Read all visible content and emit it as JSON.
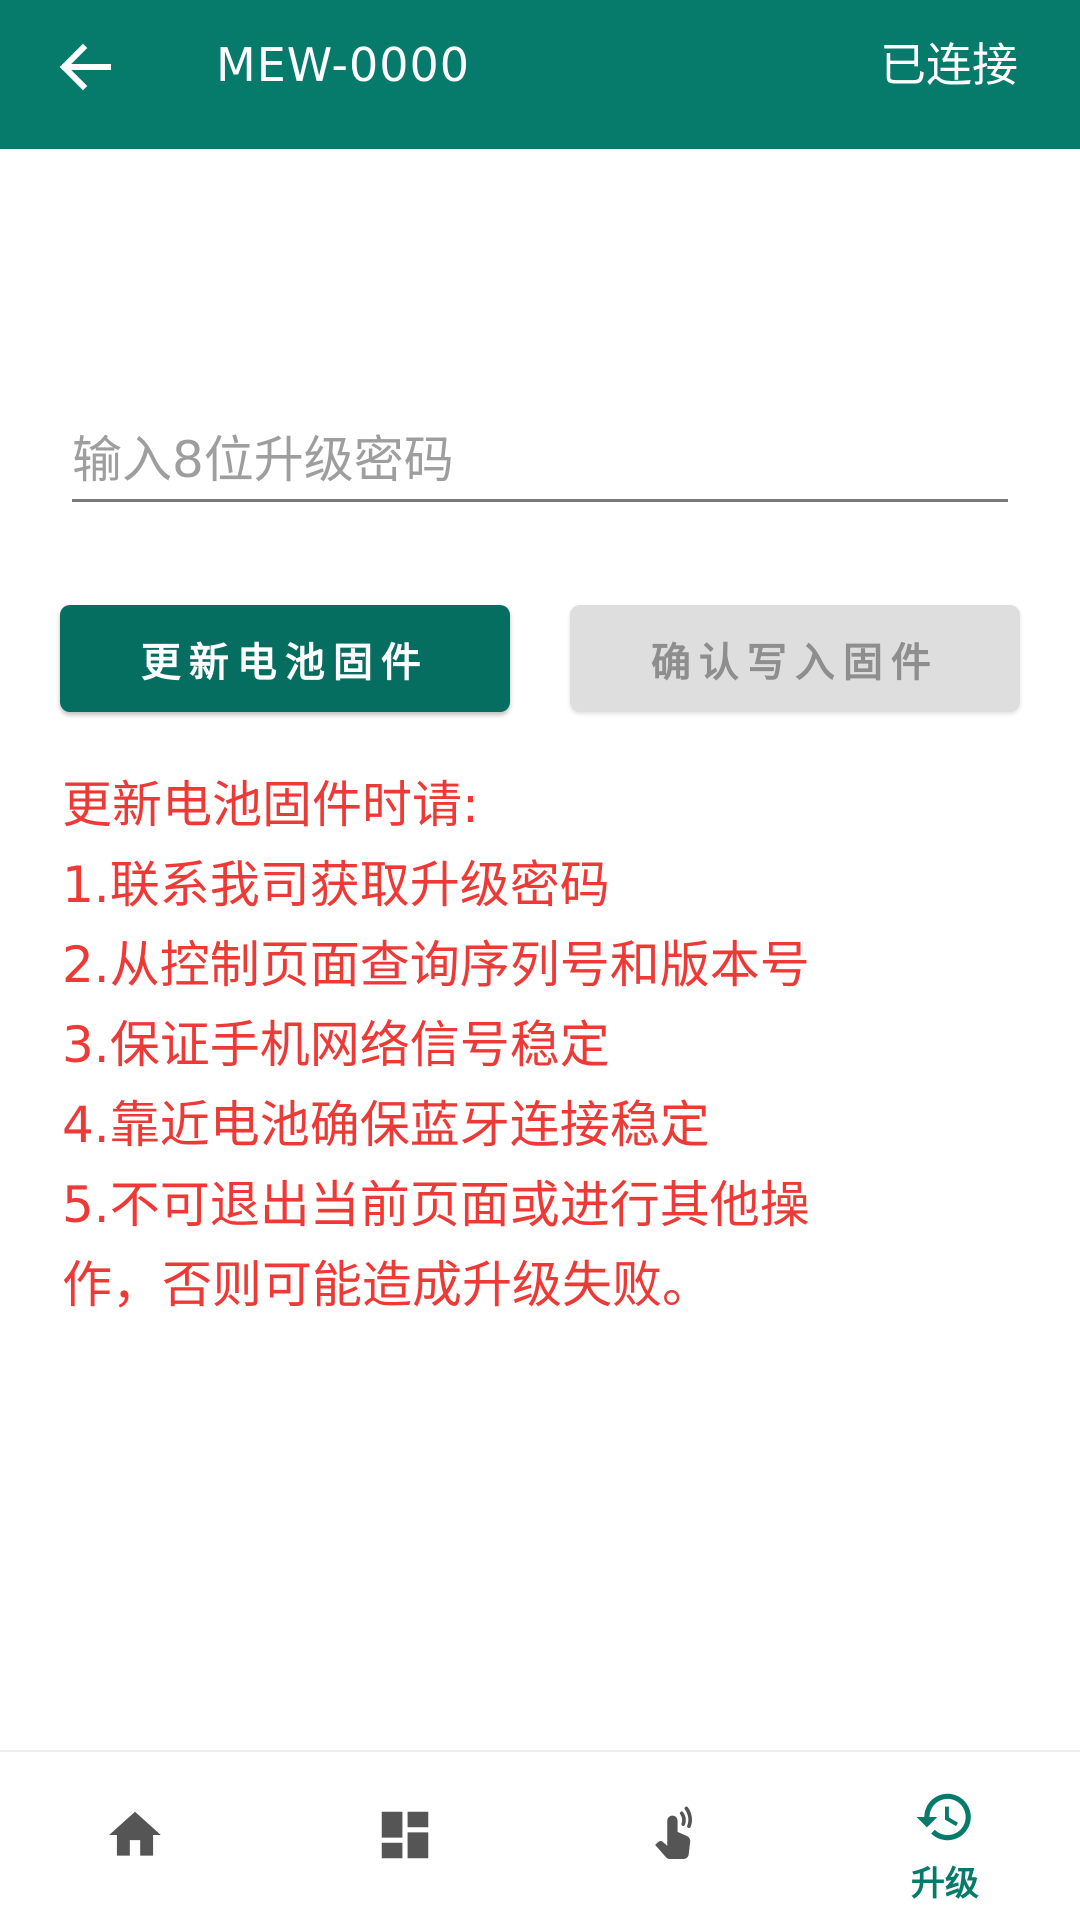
{
  "appbar": {
    "back_icon": "arrow-back-icon",
    "title": "MEW-0000",
    "status": "已连接",
    "background": "#077b6b"
  },
  "password": {
    "placeholder": "输入8位升级密码",
    "value": ""
  },
  "buttons": {
    "update_label": "更新电池固件",
    "confirm_label": "确认写入固件",
    "update_color": "#066e61",
    "confirm_color": "#dedede"
  },
  "notice": {
    "color": "#ee3a36",
    "lines": [
      "更新电池固件时请:",
      "1.联系我司获取升级密码",
      "2.从控制页面查询序列号和版本号",
      "3.保证手机网络信号稳定",
      "4.靠近电池确保蓝牙连接稳定",
      "5.不可退出当前页面或进行其他操",
      "作，否则可能造成升级失败。"
    ]
  },
  "bottom_nav": {
    "items": [
      {
        "icon": "home-icon",
        "label": ""
      },
      {
        "icon": "dashboard-icon",
        "label": ""
      },
      {
        "icon": "touch-control-icon",
        "label": ""
      },
      {
        "icon": "upgrade-history-icon",
        "label": "升级",
        "active": true
      }
    ],
    "active_color": "#077b6b",
    "inactive_color": "#555555"
  }
}
